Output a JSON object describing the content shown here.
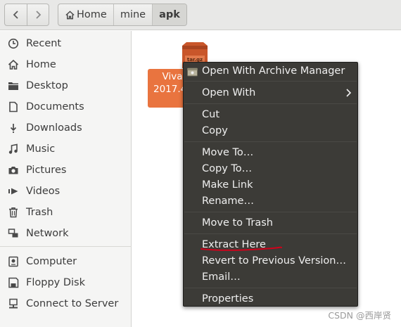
{
  "toolbar": {
    "back_icon": "chevron-left-icon",
    "forward_icon": "chevron-right-icon",
    "breadcrumb": [
      {
        "label": "Home",
        "icon": "home-icon"
      },
      {
        "label": "mine"
      },
      {
        "label": "apk",
        "active": true
      }
    ]
  },
  "sidebar": {
    "items": [
      {
        "label": "Recent",
        "icon": "clock-icon"
      },
      {
        "label": "Home",
        "icon": "home-icon"
      },
      {
        "label": "Desktop",
        "icon": "folder-icon"
      },
      {
        "label": "Documents",
        "icon": "document-icon"
      },
      {
        "label": "Downloads",
        "icon": "download-icon"
      },
      {
        "label": "Music",
        "icon": "music-icon"
      },
      {
        "label": "Pictures",
        "icon": "camera-icon"
      },
      {
        "label": "Videos",
        "icon": "video-icon"
      },
      {
        "label": "Trash",
        "icon": "trash-icon"
      },
      {
        "label": "Network",
        "icon": "network-icon"
      },
      {
        "label": "Computer",
        "icon": "drive-icon"
      },
      {
        "label": "Floppy Disk",
        "icon": "floppy-icon"
      },
      {
        "label": "Connect to Server",
        "icon": "server-icon"
      }
    ]
  },
  "file": {
    "icon": "archive-icon",
    "label_line1": "Viva",
    "label_line2": "2017.4_"
  },
  "context_menu": {
    "items": [
      {
        "label": "Open With Archive Manager",
        "icon": "archive-manager-icon"
      },
      {
        "label": "Open With",
        "submenu": true
      },
      {
        "label": "Cut"
      },
      {
        "label": "Copy"
      },
      {
        "label": "Move To…"
      },
      {
        "label": "Copy To…"
      },
      {
        "label": "Make Link"
      },
      {
        "label": "Rename…"
      },
      {
        "label": "Move to Trash"
      },
      {
        "label": "Extract Here",
        "annotated": true
      },
      {
        "label": "Revert to Previous Version…"
      },
      {
        "label": "Email…"
      },
      {
        "label": "Properties"
      }
    ],
    "annotation_color": "#d0021b"
  },
  "watermark": "CSDN @西岸贤",
  "colors": {
    "file_selection": "#e9743f",
    "menu_bg": "#3c3b37",
    "toolbar_bg": "#e8e8e7",
    "sidebar_bg": "#f5f5f4"
  }
}
